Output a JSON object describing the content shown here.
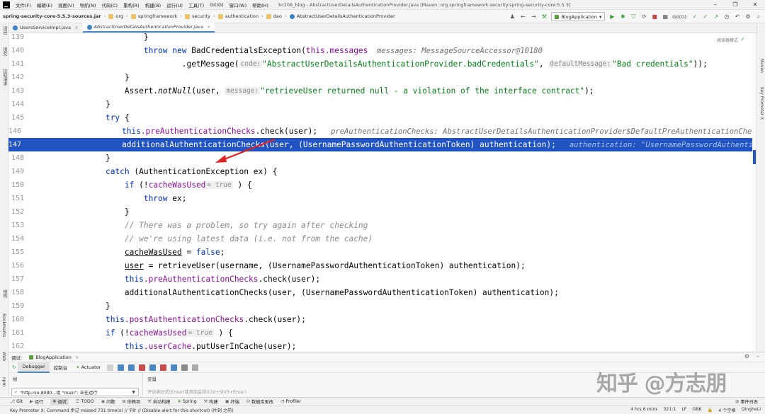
{
  "menubar": {
    "items": [
      "文件(F)",
      "编辑(E)",
      "视图(V)",
      "导航(N)",
      "代码(C)",
      "重构(R)",
      "构建(B)",
      "运行(U)",
      "工具(T)",
      "Git(G)",
      "窗口(W)",
      "帮助(H)"
    ],
    "window_title": "bc208_blog - AbstractUserDetailsAuthenticationProvider.java [Maven: org.springframework.security:spring-security-core:5.5.3]"
  },
  "breadcrumb": {
    "items": [
      "spring-security-core-5.5.3-sources.jar",
      "org",
      "springframework",
      "security",
      "authentication",
      "dao",
      "AbstractUserDetailsAuthenticationProvider"
    ]
  },
  "toolbar": {
    "run_config": "BlogApplication",
    "git_label": "Git(G):"
  },
  "tabs": [
    {
      "label": "UsersServiceImpl.java"
    },
    {
      "label": "AbstractUserDetailsAuthenticationProvider.java"
    }
  ],
  "editor": {
    "read_mode": "阅读器模式",
    "lines": [
      {
        "n": "139"
      },
      {
        "n": "140"
      },
      {
        "n": "141"
      },
      {
        "n": "142"
      },
      {
        "n": "143"
      },
      {
        "n": "144"
      },
      {
        "n": "145"
      },
      {
        "n": "146"
      },
      {
        "n": "147"
      },
      {
        "n": "148"
      },
      {
        "n": "149"
      },
      {
        "n": "150"
      },
      {
        "n": "151"
      },
      {
        "n": "152"
      },
      {
        "n": "153"
      },
      {
        "n": "154"
      },
      {
        "n": "155"
      },
      {
        "n": "156"
      },
      {
        "n": "157"
      },
      {
        "n": "158"
      },
      {
        "n": "159"
      },
      {
        "n": "160"
      },
      {
        "n": "161"
      },
      {
        "n": "162"
      }
    ],
    "code": {
      "l140_kw": "throw new ",
      "l140_a": "BadCredentialsException(",
      "l140_fld": "this.messages",
      "l140_inl": "  messages: MessageSourceAccessor@10180",
      "l141_a": ".getMessage(",
      "l141_hint1": "code:",
      "l141_str1": "\"AbstractUserDetailsAuthenticationProvider.badCredentials\"",
      "l141_b": ", ",
      "l141_hint2": "defaultMessage:",
      "l141_str2": "\"Bad credentials\"",
      "l141_c": "));",
      "l142": "}",
      "l143_a": "Assert.",
      "l143_b": "notNull",
      "l143_c": "(user, ",
      "l143_hint": "message:",
      "l143_str": "\"retrieveUser returned null - a violation of the interface contract\"",
      "l143_d": ");",
      "l144": "}",
      "l145_kw": "try",
      "l145_a": " {",
      "l146_kw": "this",
      "l146_fld": ".preAuthenticationChecks",
      "l146_a": ".check(user);",
      "l146_inl": "   preAuthenticationChecks: AbstractUserDetailsAuthenticationProvider$DefaultPreAuthenticationChecks",
      "l147_a": "additionalAuthenticationChecks(user, (UsernamePasswordAuthenticationToken) authentication);",
      "l147_inl": "   authentication: \"UsernamePasswordAuthenticationToken",
      "l148": "}",
      "l149_kw": "catch",
      "l149_a": " (AuthenticationException ex) {",
      "l150_kw": "if",
      "l150_a": " (!",
      "l150_fld": "cacheWasUsed",
      "l150_hint": "= true",
      "l150_b": " ) {",
      "l151_kw": "throw",
      "l151_a": " ex;",
      "l152": "}",
      "l153": "// There was a problem, so try again after checking",
      "l154": "// we're using latest data (i.e. not from the cache)",
      "l155_fld": "cacheWasUsed",
      "l155_a": " = ",
      "l155_kw": "false",
      "l155_b": ";",
      "l156_a": "user",
      "l156_b": " = retrieveUser(username, (UsernamePasswordAuthenticationToken) authentication);",
      "l157_kw": "this",
      "l157_fld": ".preAuthenticationChecks",
      "l157_a": ".check(user);",
      "l158_a": "additionalAuthenticationChecks(user, (UsernamePasswordAuthenticationToken) authentication);",
      "l159": "}",
      "l160_kw": "this",
      "l160_fld": ".postAuthenticationChecks",
      "l160_a": ".check(user);",
      "l161_kw": "if",
      "l161_a": " (!",
      "l161_fld": "cacheWasUsed",
      "l161_hint": "= true",
      "l161_b": " ) {",
      "l162_kw": "this",
      "l162_fld": ".userCache",
      "l162_a": ".putUserInCache(user);"
    }
  },
  "debug": {
    "title": "调试:",
    "session_tab": "BlogApplication",
    "tabs": [
      "Debugger",
      "控制台",
      "Actuator"
    ],
    "frames_header": "帧",
    "variables_header": "变量",
    "thread_value": "\"http-nio-8080...组 \"main\": 正在运行",
    "eval_placeholder": "评估表达式(Enter)或添加监视(Ctrl+Shift+Enter)"
  },
  "bottom_tools": [
    "Git",
    "运行",
    "调试",
    "TODO",
    "问题",
    "依赖项",
    "自动构建",
    "Spring",
    "构建",
    "终端",
    "数据库更改",
    "Profiler"
  ],
  "bottom_right": "事件日志",
  "status": {
    "message": "Key Promoter X: Command 步过 missed 731 time(s) // 'F8' // (Disable alert for this shortcut) (片刻 之前)",
    "time": "4 hrs 6 mins",
    "position": "321:1",
    "line_sep": "LF",
    "encoding": "GBK",
    "indent": "4 个空格",
    "user": "QingheLi"
  },
  "left_strip": [
    "项目",
    "提交",
    "拉取请求",
    "结构",
    "Bookmarks",
    "Web",
    "npm"
  ],
  "right_strip": [
    "Maven",
    "Key Promoter X"
  ],
  "watermark": "知乎 @方志朋"
}
